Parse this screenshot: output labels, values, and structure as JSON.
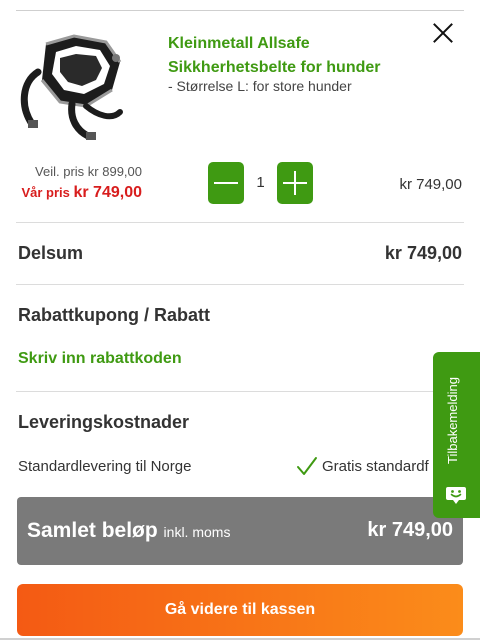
{
  "product": {
    "name": "Kleinmetall Allsafe Sikkherhetsbelte for hunder",
    "variant": "- Størrelse L: for store hunder",
    "image": "dog-harness-image",
    "price_old": "Veil. pris kr 899,00",
    "price_ours_label": "Vår pris ",
    "price_ours_value": "kr 749,00",
    "quantity": "1",
    "line_total": "kr 749,00"
  },
  "subtotal": {
    "label": "Delsum",
    "value": "kr 749,00"
  },
  "coupon": {
    "heading": "Rabattkupong / Rabatt",
    "link": "Skriv inn rabattkoden"
  },
  "shipping": {
    "heading": "Leveringskostnader",
    "method": "Standardlevering til Norge",
    "free_text": "Gratis standardf"
  },
  "total": {
    "label": "Samlet beløp",
    "incl": "inkl. moms",
    "value": "kr 749,00"
  },
  "checkout": {
    "label": "Gå videre til kassen"
  },
  "feedback": {
    "label": "Tilbakemelding"
  },
  "colors": {
    "green": "#3f9a12",
    "red": "#d81d1d",
    "total_bg": "#7a7a7a",
    "checkout_start": "#f45a14",
    "checkout_end": "#fb8c1a"
  },
  "icons": [
    "close-icon",
    "minus-icon",
    "plus-icon",
    "check-icon",
    "chat-smile-icon"
  ]
}
